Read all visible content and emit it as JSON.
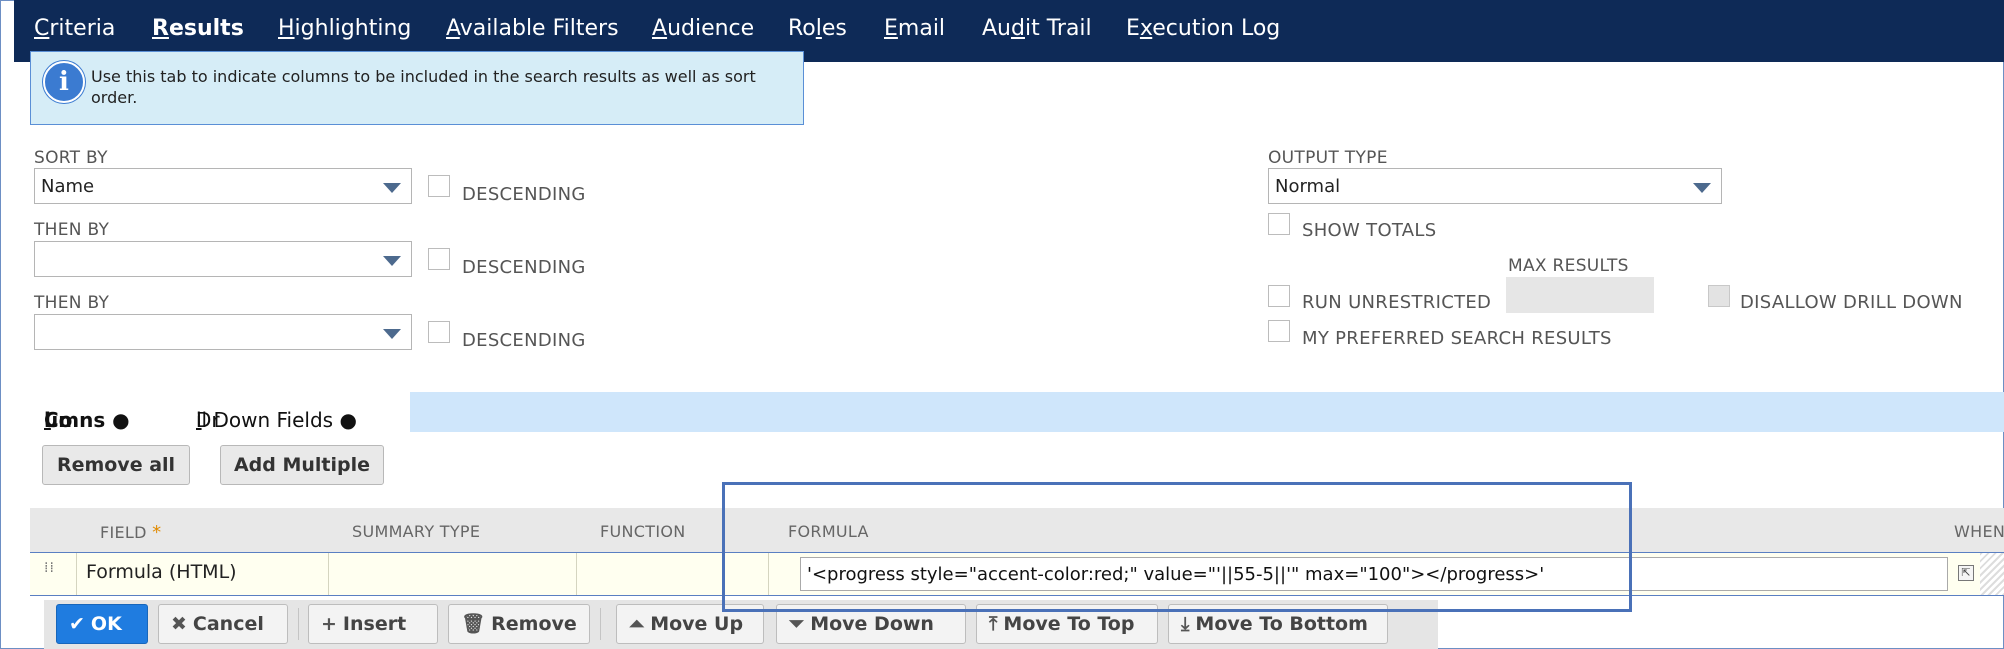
{
  "tabs": [
    {
      "pre": "",
      "u": "C",
      "post": "riteria"
    },
    {
      "pre": "",
      "u": "R",
      "post": "esults"
    },
    {
      "pre": "",
      "u": "H",
      "post": "ighlighting"
    },
    {
      "pre": "",
      "u": "A",
      "post": "vailable Filters"
    },
    {
      "pre": "",
      "u": "A",
      "post": "udience"
    },
    {
      "pre": "Ro",
      "u": "l",
      "post": "es"
    },
    {
      "pre": "",
      "u": "E",
      "post": "mail"
    },
    {
      "pre": "Au",
      "u": "d",
      "post": "it Trail"
    },
    {
      "pre": "E",
      "u": "x",
      "post": "ecution Log"
    }
  ],
  "info_text": "Use this tab to indicate columns to be included in the search results as well as sort order.",
  "sort": {
    "sort_by_label": "SORT BY",
    "sort_by_value": "Name",
    "then_by_label": "THEN BY",
    "descending_label": "DESCENDING"
  },
  "output": {
    "output_type_label": "OUTPUT TYPE",
    "output_type_value": "Normal",
    "show_totals": "SHOW TOTALS",
    "max_results": "MAX RESULTS",
    "run_unrestricted": "RUN UNRESTRICTED",
    "disallow_drill_down": "DISALLOW DRILL DOWN",
    "my_preferred": "MY PREFERRED SEARCH RESULTS"
  },
  "subtabs": {
    "columns_pre": "Co",
    "columns_u": "l",
    "columns_post": "umns ●",
    "drill_pre": "Dr",
    "drill_u": "i",
    "drill_post": "ll Down Fields ●"
  },
  "buttons": {
    "remove_all": "Remove all",
    "add_multiple": "Add Multiple"
  },
  "grid": {
    "headers": {
      "field": "FIELD",
      "summary_type": "SUMMARY TYPE",
      "function": "FUNCTION",
      "formula": "FORMULA",
      "when": "WHEN"
    },
    "row": {
      "field": "Formula (HTML)",
      "formula": "'<progress style=\"accent-color:red;\" value=\"'||55-5||'\" max=\"100\"></progress>'"
    }
  },
  "toolbar": {
    "ok": "OK",
    "cancel": "Cancel",
    "insert": "Insert",
    "remove": "Remove",
    "move_up": "Move Up",
    "move_down": "Move Down",
    "move_to_top": "Move To Top",
    "move_to_bottom": "Move To Bottom"
  }
}
